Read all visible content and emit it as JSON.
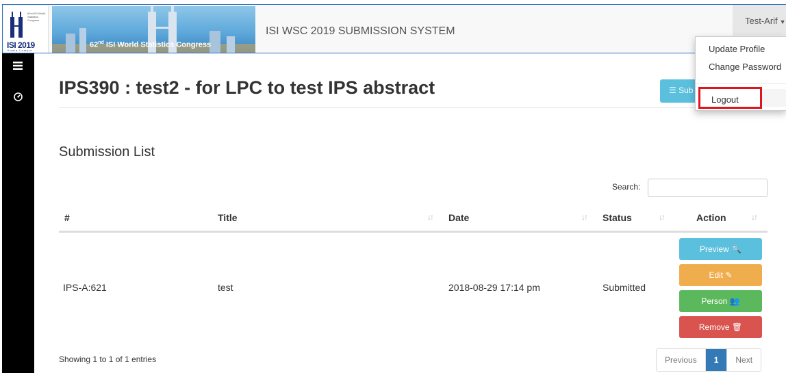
{
  "header": {
    "logo_text_main": "ISI 2019",
    "logo_text_sub": "Kuala Lumpur",
    "logo_tiny_text": "62nd ISI World Statistics Congress",
    "banner_text_prefix": "62",
    "banner_text_sup": "nd",
    "banner_text_rest": " ISI World Statistics Congress",
    "app_title": "ISI WSC 2019 SUBMISSION SYSTEM",
    "user_name": "Test-Arif"
  },
  "user_dropdown": {
    "items": [
      "Update Profile",
      "Change Password"
    ],
    "logout_label": "Logout"
  },
  "sidebar": {
    "icons": [
      "menu-icon",
      "dashboard-icon"
    ]
  },
  "page": {
    "title": "IPS390 : test2 - for LPC to test IPS abstract",
    "submit_button_label": "Sub"
  },
  "submission_list": {
    "title": "Submission List",
    "search_label": "Search:",
    "search_value": "",
    "columns": [
      "#",
      "Title",
      "Date",
      "Status",
      "Action"
    ],
    "rows": [
      {
        "id": "IPS-A:621",
        "title": "test",
        "date": "2018-08-29 17:14 pm",
        "status": "Submitted"
      }
    ],
    "actions": {
      "preview": "Preview",
      "edit": "Edit",
      "person": "Person",
      "remove": "Remove"
    },
    "footer_info": "Showing 1 to 1 of 1 entries",
    "pagination": {
      "previous": "Previous",
      "current": "1",
      "next": "Next"
    }
  },
  "colors": {
    "info": "#5bc0de",
    "warning": "#f0ad4e",
    "success": "#5cb85c",
    "danger": "#d9534f",
    "primary": "#337ab7",
    "logout_highlight": "#e0141e"
  }
}
